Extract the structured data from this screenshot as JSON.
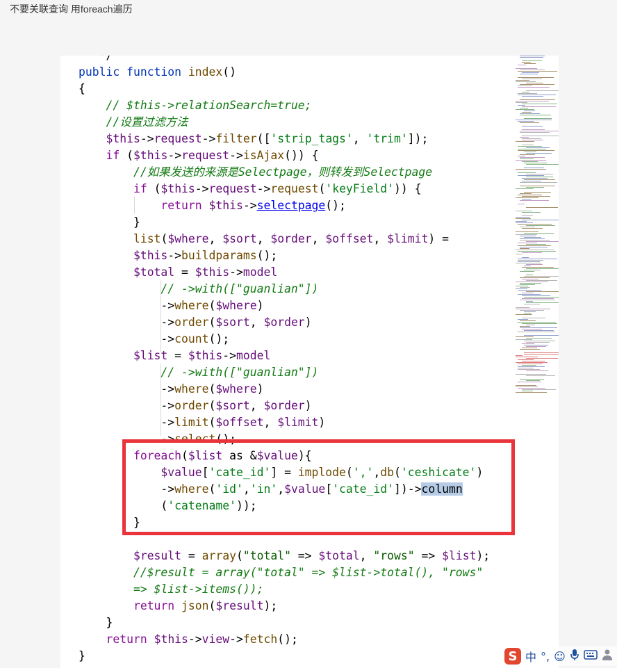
{
  "post": {
    "title": "不要关联查询 用foreach遍历"
  },
  "code": {
    "lines": [
      [
        [
          "k-plain",
          "   */"
        ]
      ],
      [
        [
          "k-blue",
          "public"
        ],
        [
          "k-plain",
          " "
        ],
        [
          "k-blue",
          "function"
        ],
        [
          "k-plain",
          " "
        ],
        [
          "k-fn",
          "index"
        ],
        [
          "k-plain",
          "()"
        ]
      ],
      [
        [
          "k-plain",
          "{"
        ]
      ],
      [
        [
          "k-plain",
          "    "
        ],
        [
          "k-com",
          "// $this->relationSearch=true;"
        ]
      ],
      [
        [
          "k-plain",
          "    "
        ],
        [
          "k-com",
          "//设置过滤方法"
        ]
      ],
      [
        [
          "k-plain",
          "    "
        ],
        [
          "k-var",
          "$this"
        ],
        [
          "k-plain",
          "->"
        ],
        [
          "k-var",
          "request"
        ],
        [
          "k-plain",
          "->"
        ],
        [
          "k-fn",
          "filter"
        ],
        [
          "k-plain",
          "(["
        ],
        [
          "k-str",
          "'strip_tags'"
        ],
        [
          "k-plain",
          ", "
        ],
        [
          "k-str",
          "'trim'"
        ],
        [
          "k-plain",
          "]);"
        ]
      ],
      [
        [
          "k-plain",
          "    "
        ],
        [
          "k-purple",
          "if"
        ],
        [
          "k-plain",
          " ("
        ],
        [
          "k-var",
          "$this"
        ],
        [
          "k-plain",
          "->"
        ],
        [
          "k-var",
          "request"
        ],
        [
          "k-plain",
          "->"
        ],
        [
          "k-fn",
          "isAjax"
        ],
        [
          "k-plain",
          "()) {"
        ]
      ],
      [
        [
          "k-plain",
          "        "
        ],
        [
          "k-com",
          "//如果发送的来源是Selectpage，则转发到Selectpage"
        ]
      ],
      [
        [
          "k-plain",
          "        "
        ],
        [
          "k-purple",
          "if"
        ],
        [
          "k-plain",
          " ("
        ],
        [
          "k-var",
          "$this"
        ],
        [
          "k-plain",
          "->"
        ],
        [
          "k-var",
          "request"
        ],
        [
          "k-plain",
          "->"
        ],
        [
          "k-fn",
          "request"
        ],
        [
          "k-plain",
          "("
        ],
        [
          "k-str",
          "'keyField'"
        ],
        [
          "k-plain",
          ")) {"
        ]
      ],
      [
        [
          "k-plain",
          "            "
        ],
        [
          "k-purple",
          "return"
        ],
        [
          "k-plain",
          " "
        ],
        [
          "k-var",
          "$this"
        ],
        [
          "k-plain",
          "->"
        ],
        [
          "link",
          "selectpage"
        ],
        [
          "k-plain",
          "();"
        ]
      ],
      [
        [
          "k-plain",
          "        }"
        ]
      ],
      [
        [
          "k-plain",
          "        "
        ],
        [
          "k-fn",
          "list"
        ],
        [
          "k-plain",
          "("
        ],
        [
          "k-var",
          "$where"
        ],
        [
          "k-plain",
          ", "
        ],
        [
          "k-var",
          "$sort"
        ],
        [
          "k-plain",
          ", "
        ],
        [
          "k-var",
          "$order"
        ],
        [
          "k-plain",
          ", "
        ],
        [
          "k-var",
          "$offset"
        ],
        [
          "k-plain",
          ", "
        ],
        [
          "k-var",
          "$limit"
        ],
        [
          "k-plain",
          ") ="
        ]
      ],
      [
        [
          "k-plain",
          "        "
        ],
        [
          "k-var",
          "$this"
        ],
        [
          "k-plain",
          "->"
        ],
        [
          "k-fn",
          "buildparams"
        ],
        [
          "k-plain",
          "();"
        ]
      ],
      [
        [
          "k-plain",
          "        "
        ],
        [
          "k-var",
          "$total"
        ],
        [
          "k-plain",
          " = "
        ],
        [
          "k-var",
          "$this"
        ],
        [
          "k-plain",
          "->"
        ],
        [
          "k-var",
          "model"
        ]
      ],
      [
        [
          "k-plain",
          "            "
        ],
        [
          "k-com",
          "// ->with([\"guanlian\"])"
        ]
      ],
      [
        [
          "k-plain",
          "            ->"
        ],
        [
          "k-fn",
          "where"
        ],
        [
          "k-plain",
          "("
        ],
        [
          "k-var",
          "$where"
        ],
        [
          "k-plain",
          ")"
        ]
      ],
      [
        [
          "k-plain",
          "            ->"
        ],
        [
          "k-fn",
          "order"
        ],
        [
          "k-plain",
          "("
        ],
        [
          "k-var",
          "$sort"
        ],
        [
          "k-plain",
          ", "
        ],
        [
          "k-var",
          "$order"
        ],
        [
          "k-plain",
          ")"
        ]
      ],
      [
        [
          "k-plain",
          "            ->"
        ],
        [
          "k-fn",
          "count"
        ],
        [
          "k-plain",
          "();"
        ]
      ],
      [
        [
          "k-plain",
          "        "
        ],
        [
          "k-var",
          "$list"
        ],
        [
          "k-plain",
          " = "
        ],
        [
          "k-var",
          "$this"
        ],
        [
          "k-plain",
          "->"
        ],
        [
          "k-var",
          "model"
        ]
      ],
      [
        [
          "k-plain",
          "            "
        ],
        [
          "k-com",
          "// ->with([\"guanlian\"])"
        ]
      ],
      [
        [
          "k-plain",
          "            ->"
        ],
        [
          "k-fn",
          "where"
        ],
        [
          "k-plain",
          "("
        ],
        [
          "k-var",
          "$where"
        ],
        [
          "k-plain",
          ")"
        ]
      ],
      [
        [
          "k-plain",
          "            ->"
        ],
        [
          "k-fn",
          "order"
        ],
        [
          "k-plain",
          "("
        ],
        [
          "k-var",
          "$sort"
        ],
        [
          "k-plain",
          ", "
        ],
        [
          "k-var",
          "$order"
        ],
        [
          "k-plain",
          ")"
        ]
      ],
      [
        [
          "k-plain",
          "            ->"
        ],
        [
          "k-fn",
          "limit"
        ],
        [
          "k-plain",
          "("
        ],
        [
          "k-var",
          "$offset"
        ],
        [
          "k-plain",
          ", "
        ],
        [
          "k-var",
          "$limit"
        ],
        [
          "k-plain",
          ")"
        ]
      ],
      [
        [
          "k-plain",
          "            ->"
        ],
        [
          "k-fn",
          "select"
        ],
        [
          "k-plain",
          "();"
        ]
      ],
      [
        [
          "k-plain",
          "        "
        ],
        [
          "k-purple",
          "foreach"
        ],
        [
          "k-plain",
          "("
        ],
        [
          "k-var",
          "$list"
        ],
        [
          "k-plain",
          " as &"
        ],
        [
          "k-var",
          "$value"
        ],
        [
          "k-plain",
          "){"
        ]
      ],
      [
        [
          "k-plain",
          "            "
        ],
        [
          "k-var",
          "$value"
        ],
        [
          "k-plain",
          "["
        ],
        [
          "k-str",
          "'cate_id'"
        ],
        [
          "k-plain",
          "] = "
        ],
        [
          "k-fn",
          "implode"
        ],
        [
          "k-plain",
          "("
        ],
        [
          "k-str",
          "','"
        ],
        [
          "k-plain",
          ","
        ],
        [
          "k-fn",
          "db"
        ],
        [
          "k-plain",
          "("
        ],
        [
          "k-str",
          "'ceshicate'"
        ],
        [
          "k-plain",
          ")"
        ]
      ],
      [
        [
          "k-plain",
          "            ->"
        ],
        [
          "k-fn",
          "where"
        ],
        [
          "k-plain",
          "("
        ],
        [
          "k-str",
          "'id'"
        ],
        [
          "k-plain",
          ","
        ],
        [
          "k-str",
          "'in'"
        ],
        [
          "k-plain",
          ","
        ],
        [
          "k-var",
          "$value"
        ],
        [
          "k-plain",
          "["
        ],
        [
          "k-str",
          "'cate_id'"
        ],
        [
          "k-plain",
          "])->"
        ],
        [
          "sel",
          "column"
        ]
      ],
      [
        [
          "k-plain",
          "            ("
        ],
        [
          "k-str",
          "'catename'"
        ],
        [
          "k-plain",
          "));"
        ]
      ],
      [
        [
          "k-plain",
          "        }"
        ]
      ],
      [
        [
          "k-plain",
          ""
        ]
      ],
      [
        [
          "k-plain",
          "        "
        ],
        [
          "k-var",
          "$result"
        ],
        [
          "k-plain",
          " = "
        ],
        [
          "k-fn",
          "array"
        ],
        [
          "k-plain",
          "("
        ],
        [
          "k-dq",
          "\"total\""
        ],
        [
          "k-plain",
          " => "
        ],
        [
          "k-var",
          "$total"
        ],
        [
          "k-plain",
          ", "
        ],
        [
          "k-dq",
          "\"rows\""
        ],
        [
          "k-plain",
          " => "
        ],
        [
          "k-var",
          "$list"
        ],
        [
          "k-plain",
          ");"
        ]
      ],
      [
        [
          "k-plain",
          "        "
        ],
        [
          "k-com",
          "//$result = array(\"total\" => $list->total(), \"rows\""
        ]
      ],
      [
        [
          "k-plain",
          "        "
        ],
        [
          "k-com",
          "=> $list->items());"
        ]
      ],
      [
        [
          "k-plain",
          "        "
        ],
        [
          "k-purple",
          "return"
        ],
        [
          "k-plain",
          " "
        ],
        [
          "k-fn",
          "json"
        ],
        [
          "k-plain",
          "("
        ],
        [
          "k-var",
          "$result"
        ],
        [
          "k-plain",
          ");"
        ]
      ],
      [
        [
          "k-plain",
          "    }"
        ]
      ],
      [
        [
          "k-plain",
          "    "
        ],
        [
          "k-purple",
          "return"
        ],
        [
          "k-plain",
          " "
        ],
        [
          "k-var",
          "$this"
        ],
        [
          "k-plain",
          "->"
        ],
        [
          "k-var",
          "view"
        ],
        [
          "k-plain",
          "->"
        ],
        [
          "k-fn",
          "fetch"
        ],
        [
          "k-plain",
          "();"
        ]
      ],
      [
        [
          "k-plain",
          "}"
        ]
      ]
    ]
  },
  "ime_toolbar": {
    "logo": "S",
    "mode": "中",
    "punct": "°,",
    "icons": [
      "emoji-icon",
      "microphone-icon",
      "keyboard-icon",
      "person-icon"
    ]
  },
  "colors": {
    "highlight_border": "#e8343a",
    "keyword": "#0033b3",
    "string": "#067d17",
    "comment": "#127a12"
  }
}
